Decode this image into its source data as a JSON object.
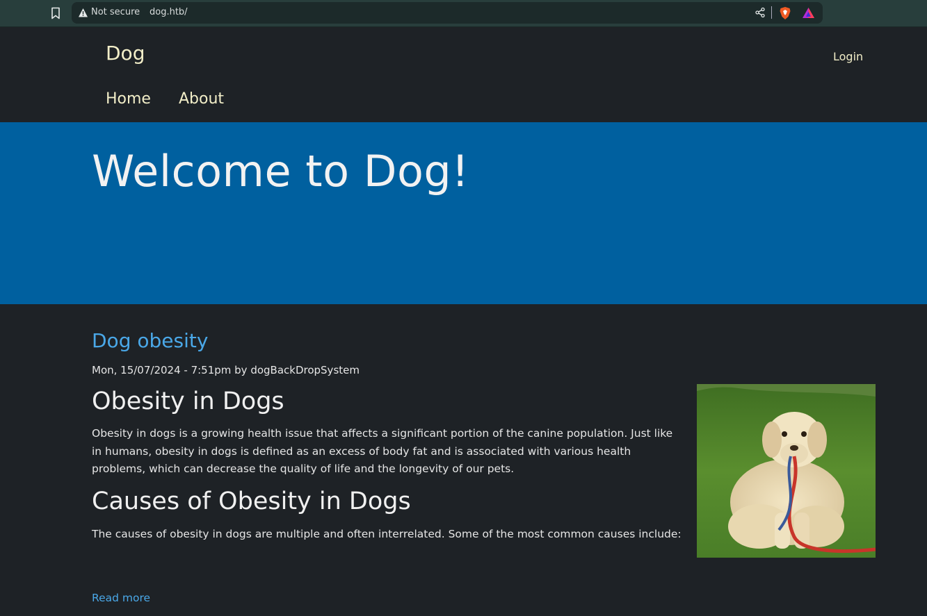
{
  "browser": {
    "security_label": "Not secure",
    "url": "dog.htb/"
  },
  "site": {
    "name": "Dog",
    "login_label": "Login",
    "nav": [
      {
        "label": "Home"
      },
      {
        "label": "About"
      }
    ]
  },
  "banner": {
    "heading": "Welcome to Dog!"
  },
  "article": {
    "title": "Dog obesity",
    "meta": "Mon, 15/07/2024 - 7:51pm by dogBackDropSystem",
    "heading1": "Obesity in Dogs",
    "paragraph1": "Obesity in dogs is a growing health issue that affects a significant portion of the canine population. Just like in humans, obesity in dogs is defined as an excess of body fat and is associated with various health problems, which can decrease the quality of life and the longevity of our pets.",
    "heading2": "Causes of Obesity in Dogs",
    "paragraph2": "The causes of obesity in dogs are multiple and often interrelated. Some of the most common causes include:",
    "read_more": "Read more"
  },
  "colors": {
    "banner": "#00609f",
    "link": "#4aa8e8",
    "header_text": "#f2eec8",
    "background": "#1e2226"
  },
  "icons": [
    "bookmark-icon",
    "warning-icon",
    "share-icon",
    "brave-shield-icon",
    "brave-rewards-icon"
  ]
}
